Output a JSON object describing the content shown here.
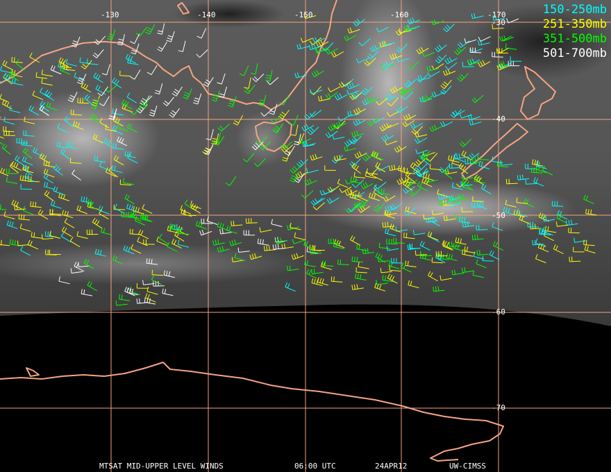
{
  "map": {
    "lon_labels": [
      "-130",
      "-140",
      "-150",
      "-160",
      "-170"
    ],
    "lat_labels": [
      "-30",
      "-40",
      "-50",
      "-60",
      "-70"
    ],
    "grid_color": "#f4a582",
    "coast_color": "#f4a582",
    "land_mask_color": "#000000"
  },
  "legend": [
    {
      "label": "150-250mb",
      "color": "#00ffff"
    },
    {
      "label": "251-350mb",
      "color": "#ffff00"
    },
    {
      "label": "351-500mb",
      "color": "#00ff00"
    },
    {
      "label": "501-700mb",
      "color": "#ffffff"
    }
  ],
  "footer": {
    "product": "MTSAT MID-UPPER LEVEL WINDS",
    "time": "06:00 UTC",
    "date": "24APR12",
    "source": "UW-CIMSS"
  }
}
